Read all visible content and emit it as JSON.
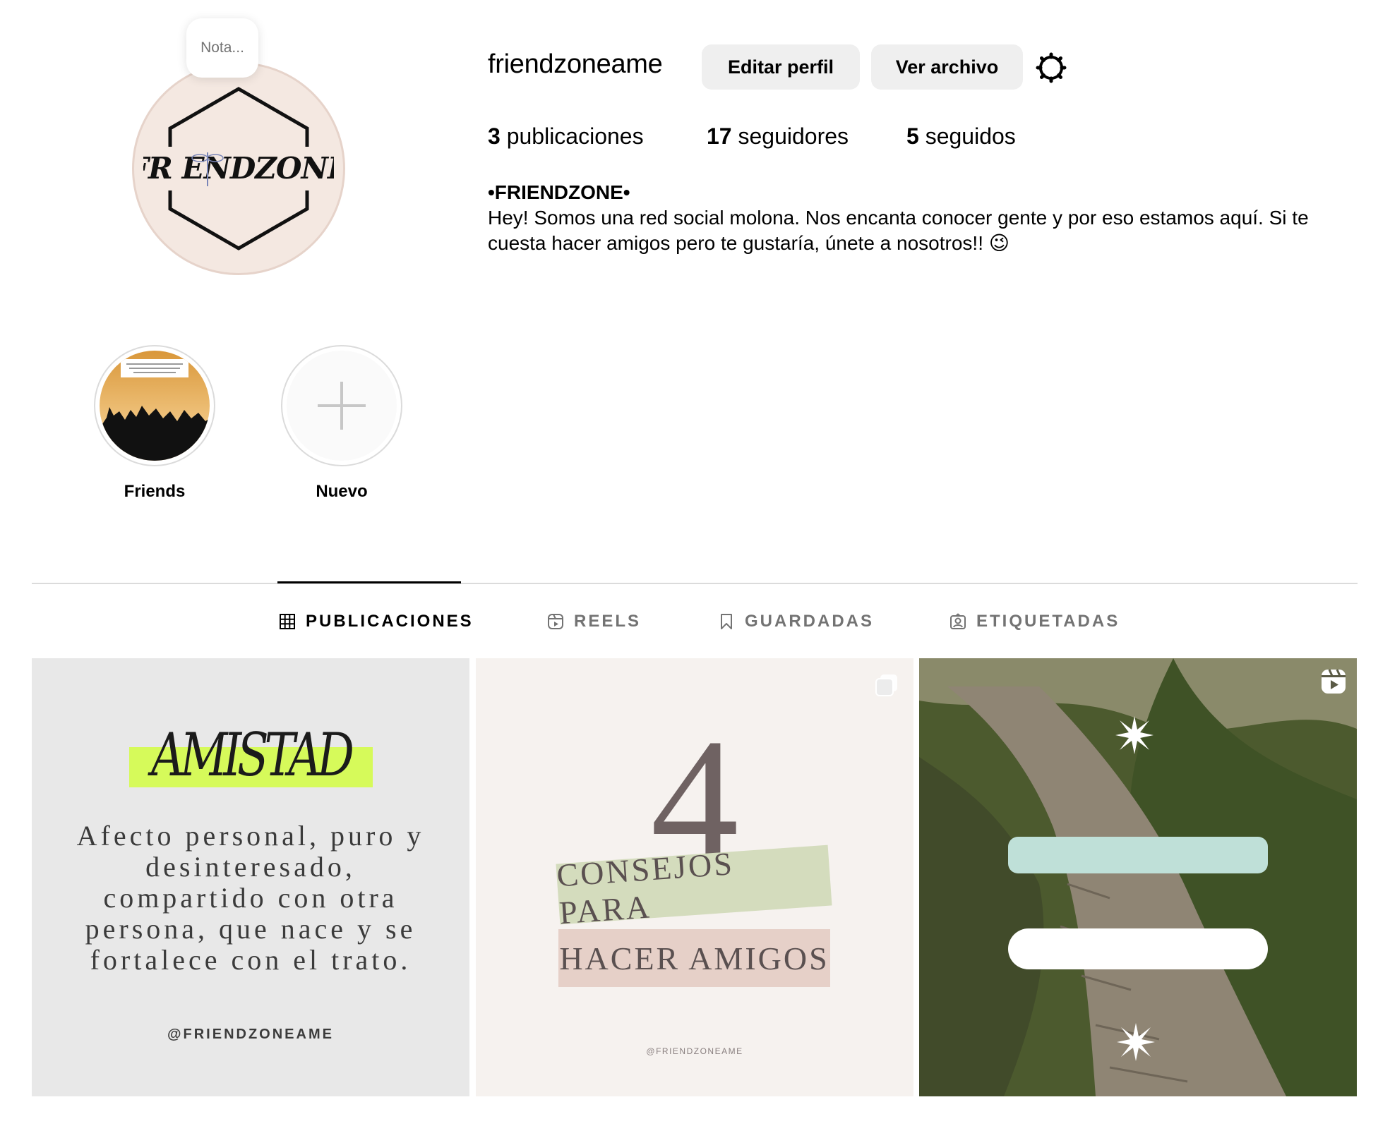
{
  "profile": {
    "note_placeholder": "Nota...",
    "avatar_brand": "FRIENDZONE",
    "username": "friendzoneame",
    "edit_profile_label": "Editar perfil",
    "view_archive_label": "Ver archivo",
    "stats": {
      "posts_count": "3",
      "posts_label": "publicaciones",
      "followers_count": "17",
      "followers_label": "seguidores",
      "following_count": "5",
      "following_label": "seguidos"
    },
    "bio_name": "•FRIENDZONE•",
    "bio_text": "Hey! Somos una red social molona. Nos encanta conocer gente y por eso estamos aquí. Si te cuesta hacer amigos pero te gustaría, únete a nosotros!! 😉"
  },
  "highlights": [
    {
      "label": "Friends",
      "icon": "crowd-photo"
    },
    {
      "label": "Nuevo",
      "icon": "plus-icon"
    }
  ],
  "tabs": [
    {
      "label": "PUBLICACIONES",
      "icon": "grid-icon",
      "active": true
    },
    {
      "label": "REELS",
      "icon": "reels-icon",
      "active": false
    },
    {
      "label": "GUARDADAS",
      "icon": "bookmark-icon",
      "active": false
    },
    {
      "label": "ETIQUETADAS",
      "icon": "tagged-icon",
      "active": false
    }
  ],
  "posts": [
    {
      "type": "image",
      "title": "AMISTAD",
      "text": "Afecto personal, puro y desinteresado, compartido con otra persona, que nace y se fortalece con el trato.",
      "handle": "@FRIENDZONEAME",
      "accent": "#d6fa5a"
    },
    {
      "type": "carousel",
      "number": "4",
      "line1": "CONSEJOS PARA",
      "line2": "HACER AMIGOS",
      "handle": "@FRIENDZONEAME",
      "icon": "carousel-icon"
    },
    {
      "type": "reel",
      "icon": "reel-icon"
    }
  ],
  "colors": {
    "button_bg": "#efefef",
    "divider": "#dbdbdb",
    "muted_text": "#737373",
    "avatar_bg": "#f4e8e1"
  }
}
